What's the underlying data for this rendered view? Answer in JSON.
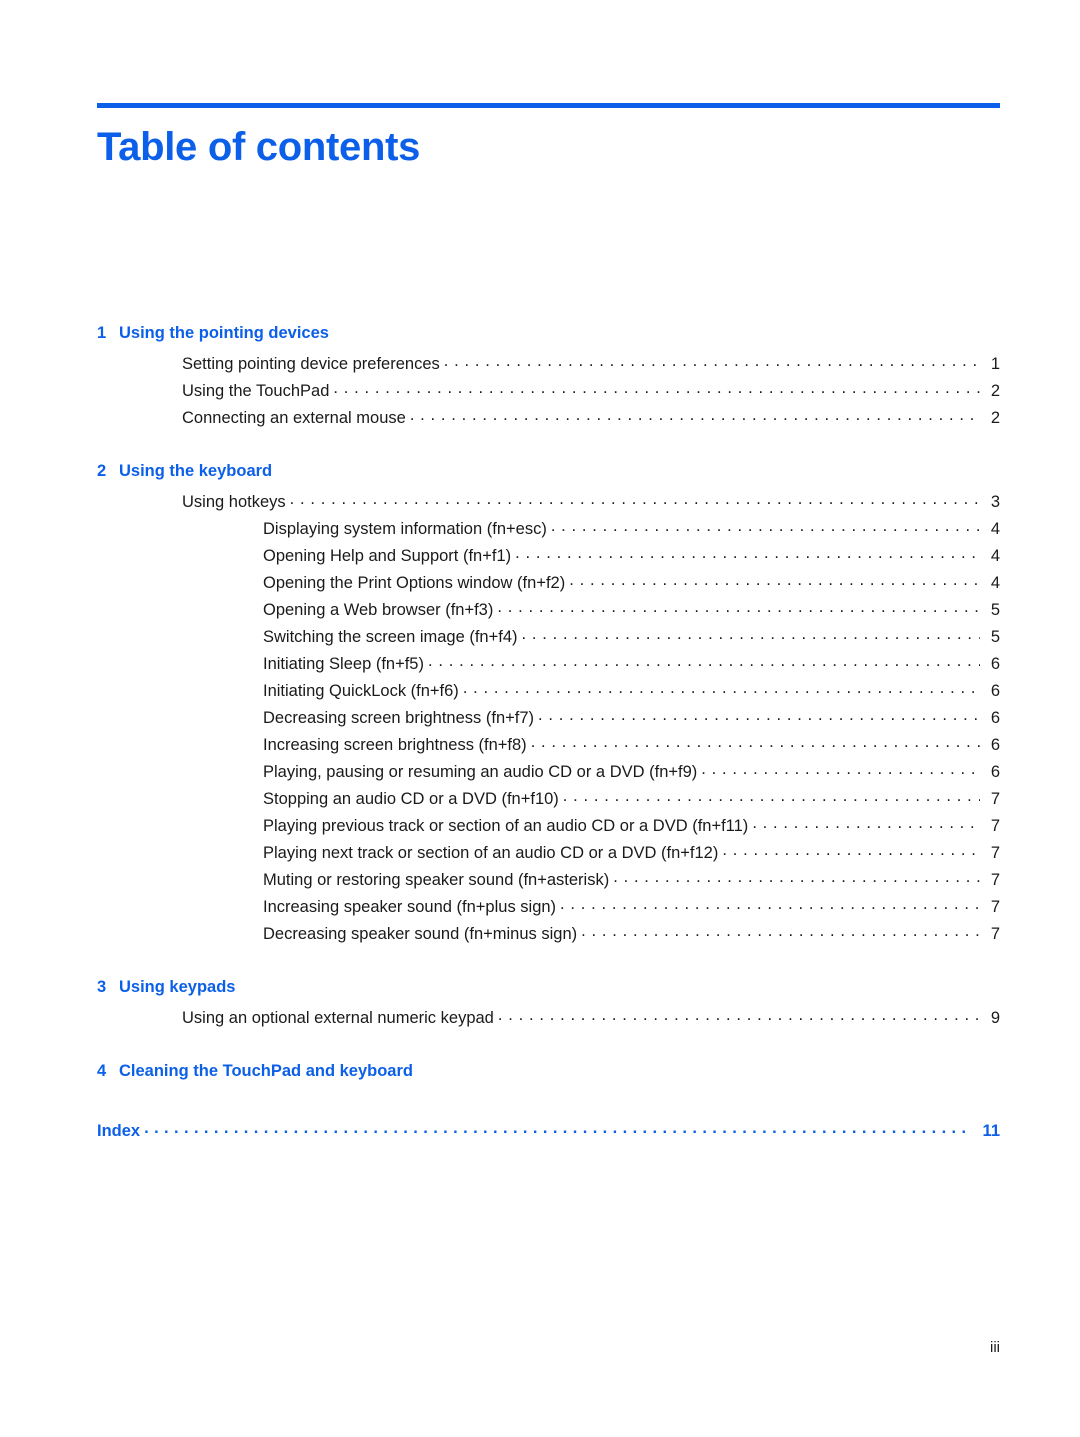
{
  "document": {
    "title": "Table of contents",
    "accent_color": "#0B5FE8",
    "text_color": "#1a1a1a",
    "footer_page_number": "iii"
  },
  "toc": {
    "chapters": [
      {
        "number": "1",
        "title": "Using the pointing devices",
        "entries": [
          {
            "level": 1,
            "label": "Setting pointing device preferences",
            "page": "1"
          },
          {
            "level": 1,
            "label": "Using the TouchPad",
            "page": "2"
          },
          {
            "level": 1,
            "label": "Connecting an external mouse",
            "page": "2"
          }
        ]
      },
      {
        "number": "2",
        "title": "Using the keyboard",
        "entries": [
          {
            "level": 1,
            "label": "Using hotkeys",
            "page": "3"
          },
          {
            "level": 2,
            "label": "Displaying system information (fn+esc)",
            "page": "4"
          },
          {
            "level": 2,
            "label": "Opening Help and Support (fn+f1)",
            "page": "4"
          },
          {
            "level": 2,
            "label": "Opening the Print Options window (fn+f2)",
            "page": "4"
          },
          {
            "level": 2,
            "label": "Opening a Web browser (fn+f3)",
            "page": "5"
          },
          {
            "level": 2,
            "label": "Switching the screen image (fn+f4)",
            "page": "5"
          },
          {
            "level": 2,
            "label": "Initiating Sleep (fn+f5)",
            "page": "6"
          },
          {
            "level": 2,
            "label": "Initiating QuickLock (fn+f6)",
            "page": "6"
          },
          {
            "level": 2,
            "label": "Decreasing screen brightness (fn+f7)",
            "page": "6"
          },
          {
            "level": 2,
            "label": "Increasing screen brightness (fn+f8)",
            "page": "6"
          },
          {
            "level": 2,
            "label": "Playing, pausing or resuming an audio CD or a DVD (fn+f9)",
            "page": "6"
          },
          {
            "level": 2,
            "label": "Stopping an audio CD or a DVD (fn+f10)",
            "page": "7"
          },
          {
            "level": 2,
            "label": "Playing previous track or section of an audio CD or a DVD (fn+f11)",
            "page": "7"
          },
          {
            "level": 2,
            "label": "Playing next track or section of an audio CD or a DVD (fn+f12)",
            "page": "7"
          },
          {
            "level": 2,
            "label": "Muting or restoring speaker sound (fn+asterisk)",
            "page": "7"
          },
          {
            "level": 2,
            "label": "Increasing speaker sound (fn+plus sign)",
            "page": "7"
          },
          {
            "level": 2,
            "label": "Decreasing speaker sound (fn+minus sign)",
            "page": "7"
          }
        ]
      },
      {
        "number": "3",
        "title": "Using keypads",
        "entries": [
          {
            "level": 1,
            "label": "Using an optional external numeric keypad",
            "page": "9"
          }
        ]
      },
      {
        "number": "4",
        "title": "Cleaning the TouchPad and keyboard",
        "entries": []
      }
    ],
    "index": {
      "label": "Index",
      "page": "11"
    }
  }
}
